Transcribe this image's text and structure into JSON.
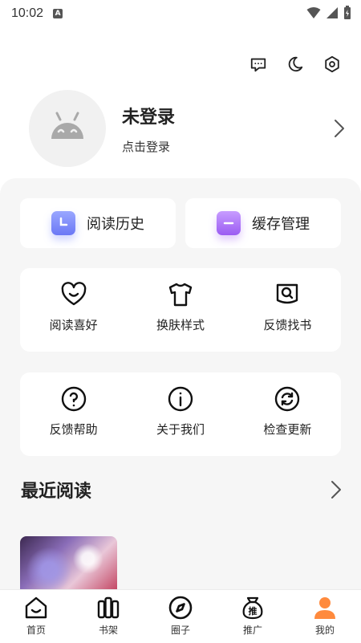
{
  "status_bar": {
    "time": "10:02",
    "notification_glyph": "A"
  },
  "header": {
    "actions": [
      "message-icon",
      "moon-icon",
      "settings-icon"
    ]
  },
  "profile": {
    "name": "未登录",
    "subtitle": "点击登录"
  },
  "quick_actions": [
    {
      "label": "阅读历史",
      "icon": "history-icon"
    },
    {
      "label": "缓存管理",
      "icon": "cache-icon"
    }
  ],
  "grid1": [
    {
      "label": "阅读喜好",
      "icon": "heart-icon"
    },
    {
      "label": "换肤样式",
      "icon": "shirt-icon"
    },
    {
      "label": "反馈找书",
      "icon": "search-book-icon"
    }
  ],
  "grid2": [
    {
      "label": "反馈帮助",
      "icon": "help-icon"
    },
    {
      "label": "关于我们",
      "icon": "info-icon"
    },
    {
      "label": "检查更新",
      "icon": "refresh-icon"
    }
  ],
  "recent": {
    "title": "最近阅读"
  },
  "tabs": [
    {
      "label": "首页",
      "icon": "home-icon"
    },
    {
      "label": "书架",
      "icon": "bookshelf-icon"
    },
    {
      "label": "圈子",
      "icon": "compass-icon"
    },
    {
      "label": "推广",
      "icon": "promote-bag-icon",
      "badge": "推"
    },
    {
      "label": "我的",
      "icon": "profile-icon",
      "active": true
    }
  ],
  "colors": {
    "accent": "#ff8a3d",
    "panel_bg": "#f6f6f6",
    "text": "#222222"
  }
}
